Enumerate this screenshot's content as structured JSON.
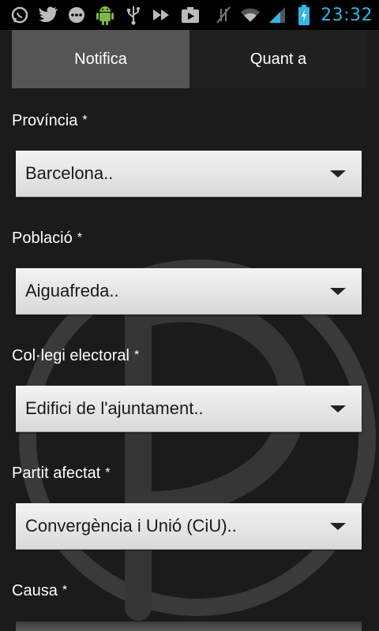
{
  "status_bar": {
    "time": "23:32",
    "icons": [
      "whatsapp-icon",
      "twitter-icon",
      "chat-bubble-icon",
      "android-icon",
      "usb-icon",
      "transfer-icon",
      "media-icon",
      "vibrate-muted-icon",
      "wifi-icon",
      "signal-icon",
      "battery-charging-icon"
    ],
    "accent_color": "#33b5e5"
  },
  "tabs": [
    {
      "label": "Notifica",
      "active": true
    },
    {
      "label": "Quant a",
      "active": false
    }
  ],
  "form": {
    "required_marker": "*",
    "fields": [
      {
        "label": "Província",
        "value": "Barcelona.."
      },
      {
        "label": "Població",
        "value": "Aiguafreda.."
      },
      {
        "label": "Col·legi electoral",
        "value": "Edifici de l'ajuntament.."
      },
      {
        "label": "Partit afectat",
        "value": "Convergència i Unió (CiU).."
      },
      {
        "label": "Causa",
        "value": ""
      }
    ]
  }
}
